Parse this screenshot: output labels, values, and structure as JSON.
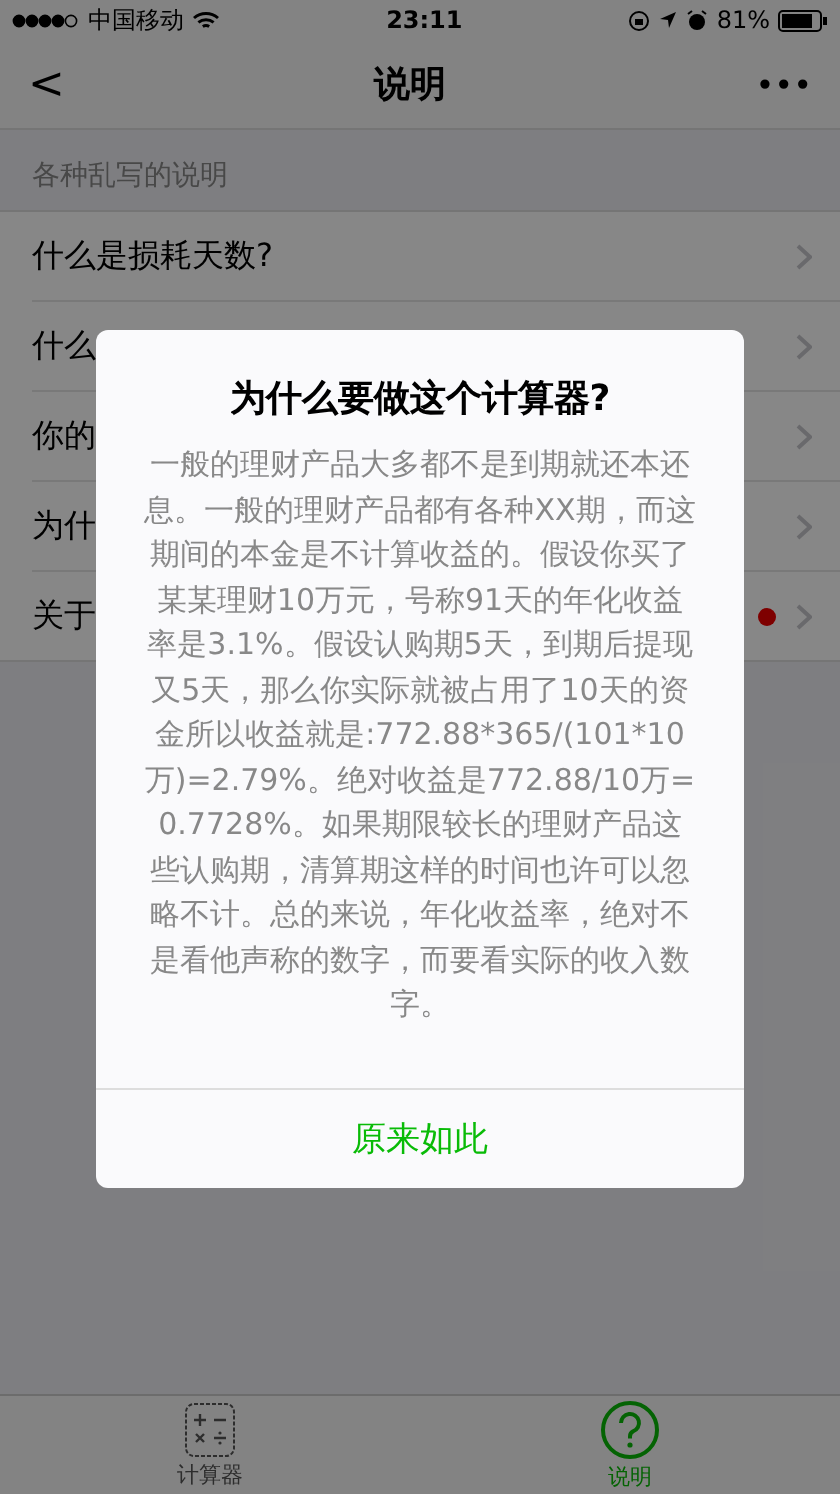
{
  "status_bar": {
    "carrier": "中国移动",
    "time": "23:11",
    "battery": "81%"
  },
  "nav": {
    "back": "<",
    "title": "说明",
    "more": "•••"
  },
  "section_header": "各种乱写的说明",
  "items": [
    {
      "label": "什么是损耗天数?",
      "dot": false
    },
    {
      "label": "什么",
      "dot": false
    },
    {
      "label": "你的",
      "dot": false
    },
    {
      "label": "为什",
      "dot": false
    },
    {
      "label": "关于",
      "dot": true
    }
  ],
  "dialog": {
    "title": "为什么要做这个计算器?",
    "body": "一般的理财产品大多都不是到期就还本还息。一般的理财产品都有各种XX期，而这期间的本金是不计算收益的。假设你买了某某理财10万元，号称91天的年化收益率是3.1%。假设认购期5天，到期后提现又5天，那么你实际就被占用了10天的资金所以收益就是:772.88*365/(101*10万)=2.79%。绝对收益是772.88/10万=0.7728%。如果期限较长的理财产品这些认购期，清算期这样的时间也许可以忽略不计。总的来说，年化收益率，绝对不是看他声称的数字，而要看实际的收入数字。",
    "button": "原来如此"
  },
  "tabs": [
    {
      "label": "计算器",
      "kind": "calculator",
      "selected": false
    },
    {
      "label": "说明",
      "kind": "help",
      "selected": true
    }
  ]
}
